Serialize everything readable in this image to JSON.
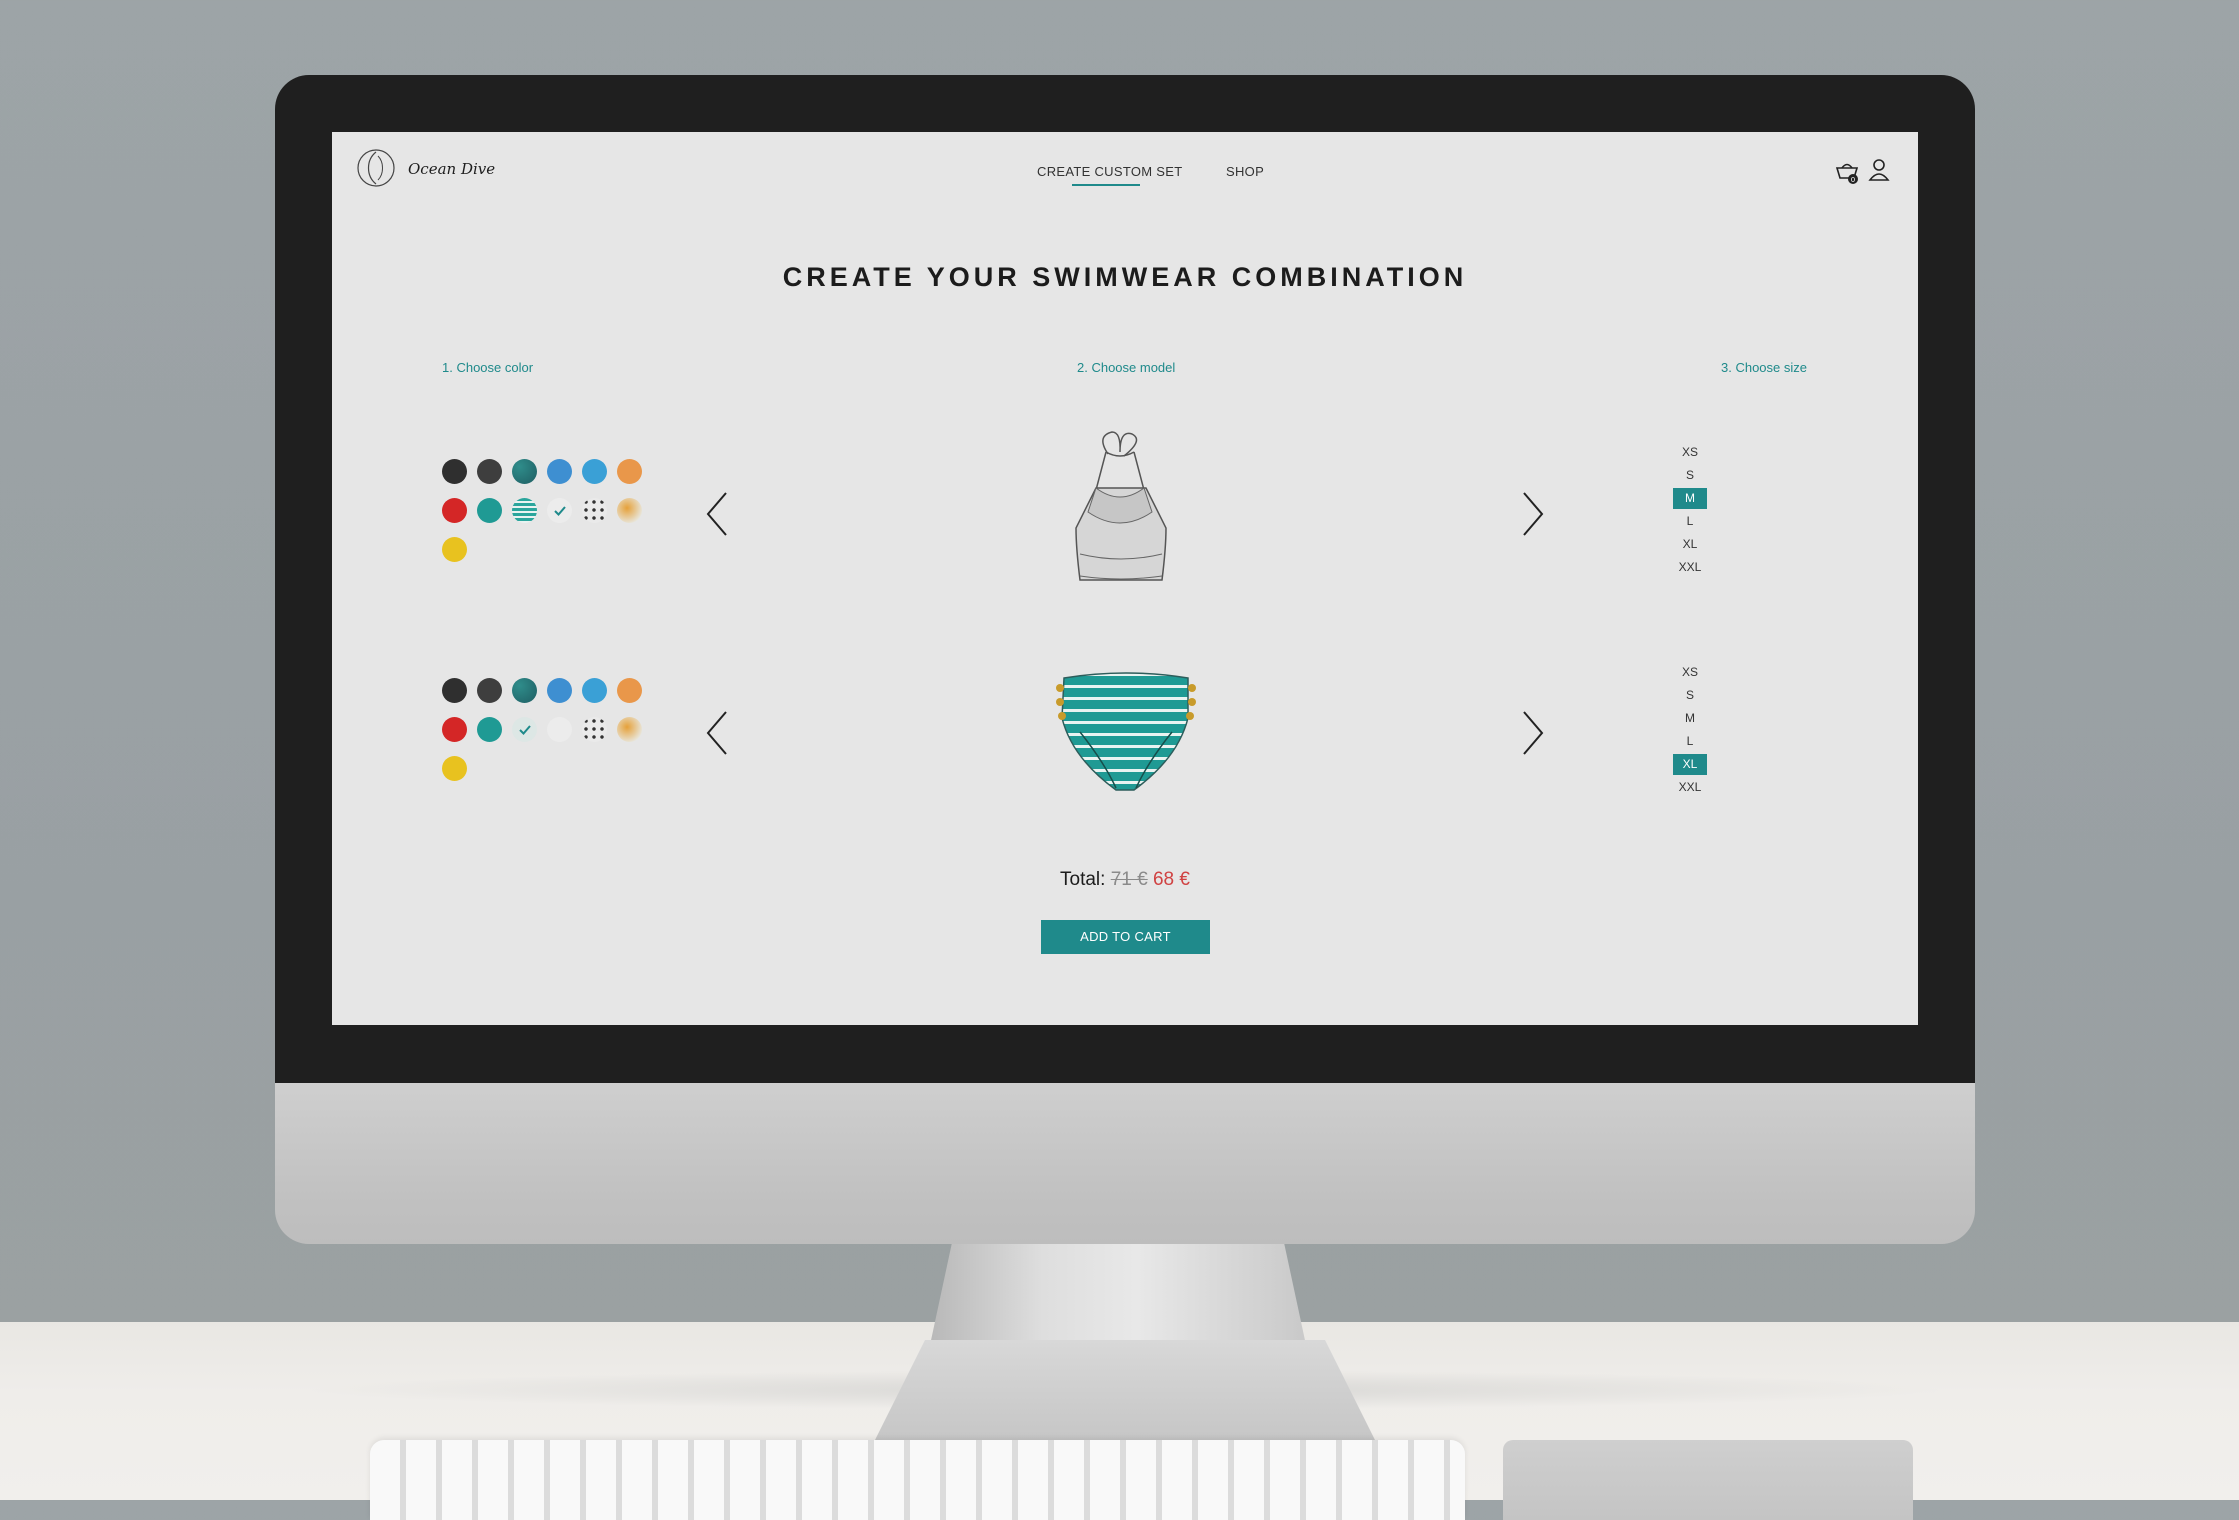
{
  "brand": {
    "name": "Ocean Dive"
  },
  "nav": {
    "items": [
      {
        "label": "CREATE CUSTOM SET",
        "active": true
      },
      {
        "label": "SHOP",
        "active": false
      }
    ],
    "icons": [
      "cart-icon",
      "user-icon"
    ]
  },
  "main": {
    "title": "CREATE YOUR SWIMWEAR COMBINATION",
    "steps": [
      "1. Choose color",
      "2. Choose model",
      "3. Choose size"
    ]
  },
  "colors": {
    "accent": "#1f8a8b",
    "sale": "#d04242",
    "palette": [
      "#2f2f2f",
      "#3e3e3e",
      "teal-leaf-pattern",
      "#3e8fd1",
      "#3aa0d6",
      "#e9974a",
      "#d42626",
      "#1f9a94",
      "teal-stripes-pattern",
      "white",
      "white-dots-pattern",
      "orange-pattern",
      "#e8c21f"
    ]
  },
  "top": {
    "selected_color": "teal-stripes-pattern (checked swatch shows white)",
    "model_icon": "halter-top-sketch",
    "sizes": [
      "XS",
      "S",
      "M",
      "L",
      "XL",
      "XXL"
    ],
    "selected_size": "M"
  },
  "bottom": {
    "selected_color": "teal-stripes-pattern",
    "model_icon": "high-waist-bottom-teal-stripes",
    "sizes": [
      "XS",
      "S",
      "M",
      "L",
      "XL",
      "XXL"
    ],
    "selected_size": "XL"
  },
  "summary": {
    "total_label": "Total:",
    "old_price": "71 €",
    "new_price": "68 €",
    "add_button": "ADD TO CART"
  }
}
